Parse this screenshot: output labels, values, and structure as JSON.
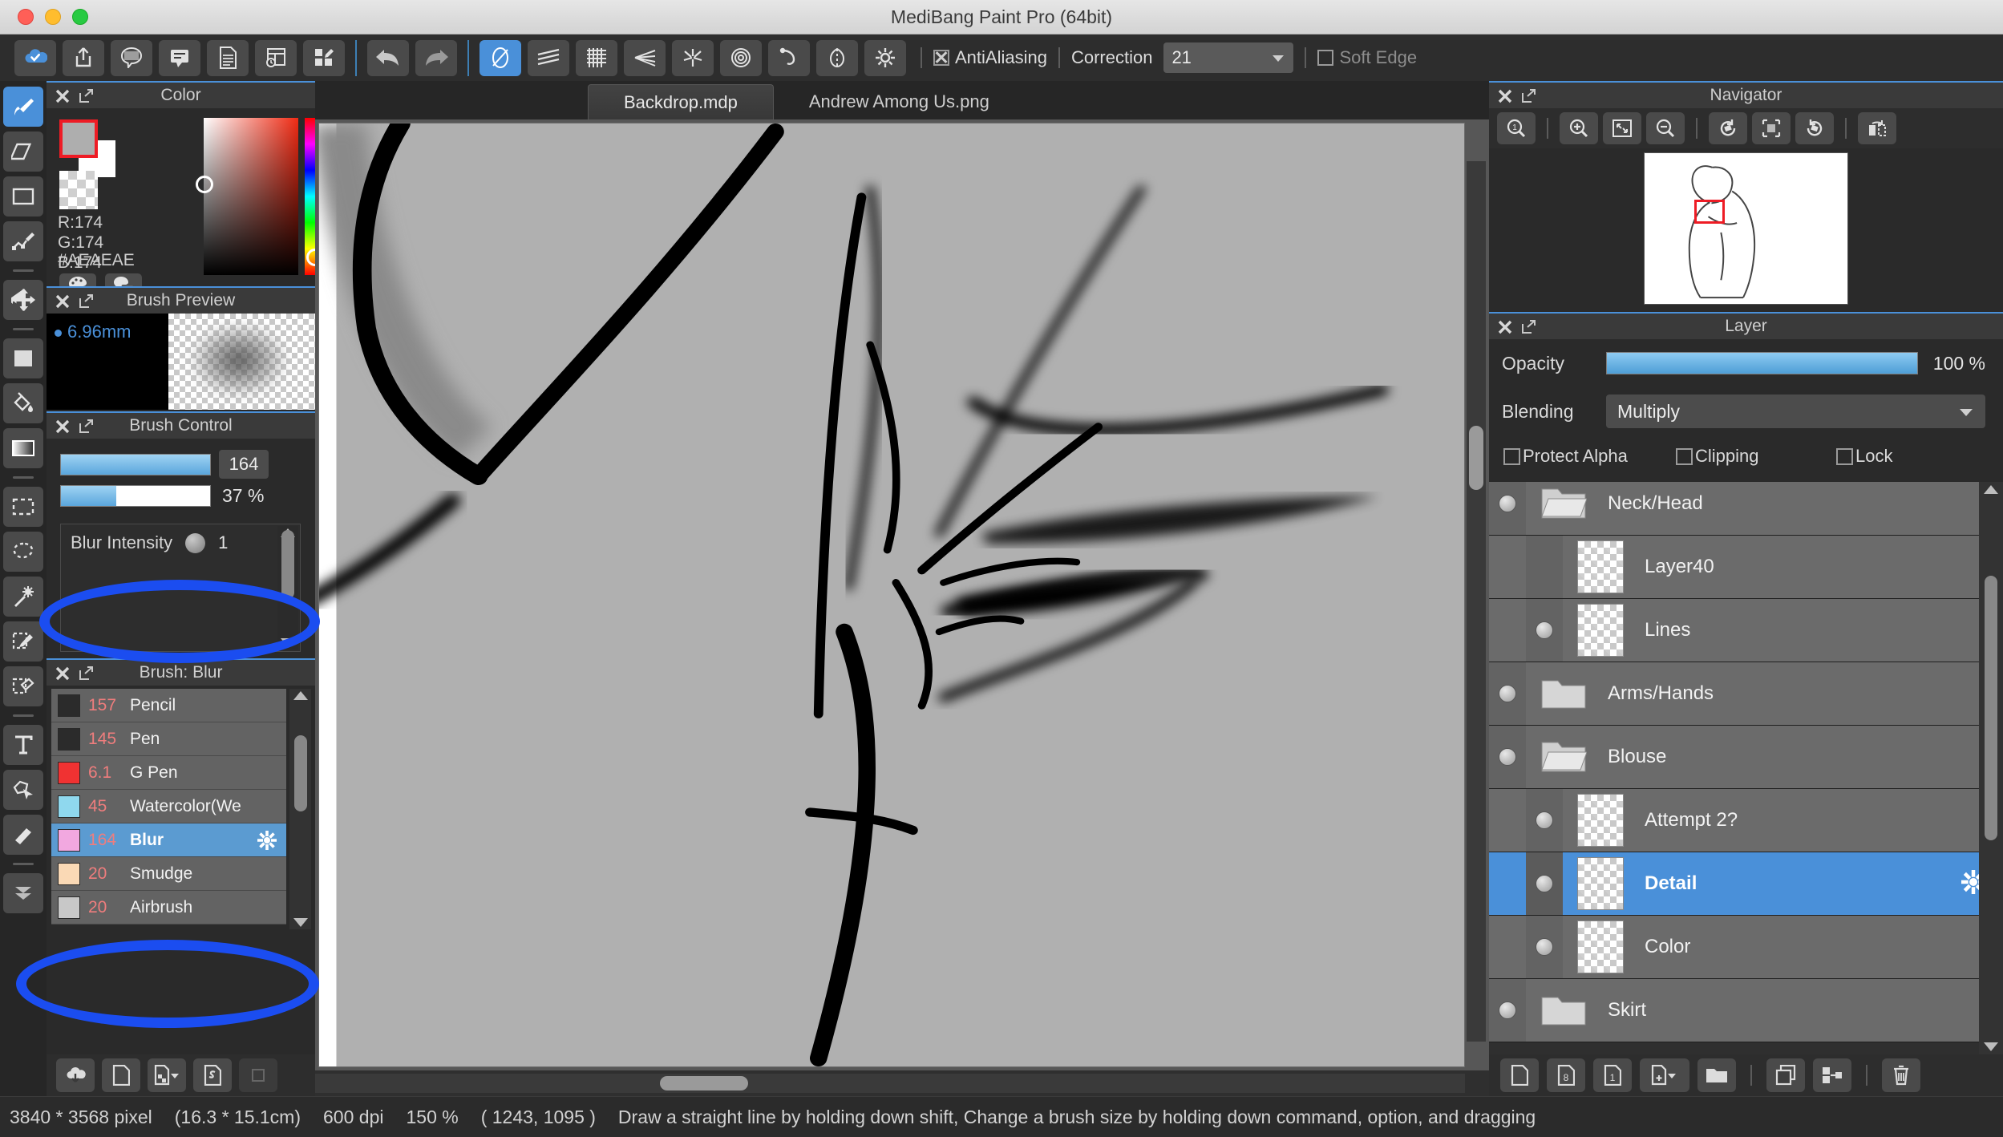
{
  "window": {
    "title": "MediBang Paint Pro (64bit)"
  },
  "toolbar": {
    "left_buttons": [
      {
        "name": "cloud-save-icon",
        "label": "Cloud"
      },
      {
        "name": "share-upload-icon",
        "label": "Share"
      },
      {
        "name": "comic-speech-icon",
        "label": "Comic"
      },
      {
        "name": "speech-balloon-icon",
        "label": "Balloon"
      },
      {
        "name": "page-icon",
        "label": "Page"
      },
      {
        "name": "page-manage-icon",
        "label": "Page Manage"
      },
      {
        "name": "panel-edit-icon",
        "label": "Panel Edit"
      }
    ],
    "undo_label": "Undo",
    "redo_label": "Redo",
    "brush_shape_buttons": [
      {
        "name": "no-correction-icon",
        "label": "No Correction",
        "active": true
      },
      {
        "name": "parallel-lines-icon",
        "label": "Parallel Line"
      },
      {
        "name": "grid-icon",
        "label": "Grid"
      },
      {
        "name": "converge-icon",
        "label": "Converging Line"
      },
      {
        "name": "radial-icon",
        "label": "Radial Line"
      },
      {
        "name": "concentric-icon",
        "label": "Concentric Circle"
      },
      {
        "name": "curve-icon",
        "label": "Curve"
      },
      {
        "name": "symmetry-icon",
        "label": "Symmetry"
      },
      {
        "name": "ruler-settings-icon",
        "label": "Ruler Settings"
      }
    ],
    "antialiasing_label": "AntiAliasing",
    "antialiasing_checked": true,
    "correction_label": "Correction",
    "correction_value": "21",
    "soft_edge_label": "Soft Edge",
    "soft_edge_checked": false
  },
  "tool_rail": [
    {
      "name": "brush-tool",
      "label": "Brush",
      "active": true
    },
    {
      "name": "eraser-tool",
      "label": "Eraser"
    },
    {
      "name": "shape-tool",
      "label": "Shape"
    },
    {
      "name": "polyline-tool",
      "label": "Polyline"
    },
    {
      "sep": true
    },
    {
      "name": "move-tool",
      "label": "Move"
    },
    {
      "sep": true
    },
    {
      "name": "fill-rect-tool",
      "label": "Fill Rect"
    },
    {
      "name": "bucket-tool",
      "label": "Bucket"
    },
    {
      "name": "gradient-tool",
      "label": "Gradient"
    },
    {
      "sep": true
    },
    {
      "name": "rect-select-tool",
      "label": "Select Rect"
    },
    {
      "name": "lasso-select-tool",
      "label": "Lasso"
    },
    {
      "name": "magic-wand-tool",
      "label": "Magic Wand"
    },
    {
      "name": "select-pen-tool",
      "label": "Select Pen"
    },
    {
      "name": "select-eraser-tool",
      "label": "Select Eraser"
    },
    {
      "sep": true
    },
    {
      "name": "text-tool",
      "label": "Text"
    },
    {
      "name": "transform-tool",
      "label": "Operation"
    },
    {
      "name": "hand-tool",
      "label": "Hand"
    },
    {
      "sep": true
    },
    {
      "name": "divide-tool",
      "label": "Divide"
    }
  ],
  "color_panel": {
    "title": "Color",
    "rgb": [
      "R:174",
      "G:174",
      "B:174"
    ],
    "hex": "#AEAEAE",
    "foreground": "#AEAEAE",
    "background": "#FFFFFF",
    "swatch_border": "#EE1C25"
  },
  "brush_preview": {
    "title": "Brush Preview",
    "size_label": "6.96mm",
    "size_color": "#4A90D9"
  },
  "brush_control": {
    "title": "Brush Control",
    "size_value": "164",
    "opacity_value": "37 %",
    "opacity_percent": 37,
    "blur_intensity_label": "Blur Intensity",
    "blur_intensity_value": "1"
  },
  "brush_list": {
    "title": "Brush: Blur",
    "rows": [
      {
        "num": "157",
        "name": "Pencil",
        "swatch": "#2b2b2b",
        "selected": false
      },
      {
        "num": "145",
        "name": "Pen",
        "swatch": "#2b2b2b",
        "selected": false
      },
      {
        "num": "6.1",
        "name": "G Pen",
        "swatch": "#f03232",
        "selected": false
      },
      {
        "num": "45",
        "name": "Watercolor(We",
        "swatch": "#8fd8ee",
        "selected": false
      },
      {
        "num": "164",
        "name": "Blur",
        "swatch": "#f2a8e0",
        "selected": true
      },
      {
        "num": "20",
        "name": "Smudge",
        "swatch": "#fad9b5",
        "selected": false
      },
      {
        "num": "20",
        "name": "Airbrush",
        "swatch": "#c8c8c8",
        "selected": false
      }
    ],
    "footer_buttons": [
      {
        "name": "download-brush-icon",
        "label": "Download Brush"
      },
      {
        "name": "add-brush-icon",
        "label": "Add Brush"
      },
      {
        "name": "add-brush-type-icon",
        "label": "Add Brush Type"
      },
      {
        "name": "script-brush-icon",
        "label": "Script Brush"
      },
      {
        "name": "brush-merge-icon",
        "label": "Merge",
        "disabled": true
      }
    ]
  },
  "tabs": [
    {
      "label": "Backdrop.mdp",
      "active": true
    },
    {
      "label": "Andrew Among Us.png",
      "active": false
    }
  ],
  "navigator": {
    "title": "Navigator",
    "buttons": [
      {
        "name": "zoom-reset-icon",
        "label": "Zoom 1:1"
      },
      {
        "name": "zoom-in-icon",
        "label": "Zoom In"
      },
      {
        "name": "fit-screen-icon",
        "label": "Fit to Screen"
      },
      {
        "name": "zoom-out-icon",
        "label": "Zoom Out"
      },
      {
        "name": "rotate-left-icon",
        "label": "Rotate Left"
      },
      {
        "name": "reset-rotate-icon",
        "label": "Reset Rotation"
      },
      {
        "name": "rotate-right-icon",
        "label": "Rotate Right"
      },
      {
        "name": "flip-horizontal-icon",
        "label": "Flip Horizontal"
      }
    ]
  },
  "layer_panel": {
    "title": "Layer",
    "opacity_label": "Opacity",
    "opacity_value": "100 %",
    "opacity_percent": 100,
    "blending_label": "Blending",
    "blending_value": "Multiply",
    "checkboxes": [
      {
        "name": "protect-alpha-checkbox",
        "label": "Protect Alpha",
        "checked": false
      },
      {
        "name": "clipping-checkbox",
        "label": "Clipping",
        "checked": false
      },
      {
        "name": "lock-checkbox",
        "label": "Lock",
        "checked": false
      }
    ],
    "layers": [
      {
        "name": "Neck/Head",
        "type": "folder-open",
        "visible": true,
        "child": false,
        "selected": false
      },
      {
        "name": "Layer40",
        "type": "layer",
        "visible": false,
        "child": true,
        "selected": false
      },
      {
        "name": "Lines",
        "type": "layer",
        "visible": true,
        "child": true,
        "selected": false
      },
      {
        "name": "Arms/Hands",
        "type": "folder-closed",
        "visible": true,
        "child": false,
        "selected": false
      },
      {
        "name": "Blouse",
        "type": "folder-open",
        "visible": true,
        "child": false,
        "selected": false
      },
      {
        "name": "Attempt 2?",
        "type": "layer",
        "visible": true,
        "child": true,
        "selected": false
      },
      {
        "name": "Detail",
        "type": "layer",
        "visible": true,
        "child": true,
        "selected": true
      },
      {
        "name": "Color",
        "type": "layer",
        "visible": true,
        "child": true,
        "selected": false
      },
      {
        "name": "Skirt",
        "type": "folder-closed",
        "visible": true,
        "child": false,
        "selected": false
      }
    ],
    "footer_buttons": [
      {
        "name": "new-layer-icon",
        "label": "Add Layer"
      },
      {
        "name": "new-8bit-layer-icon",
        "label": "Add 8bit Layer"
      },
      {
        "name": "new-1bit-layer-icon",
        "label": "Add 1bit Layer"
      },
      {
        "name": "add-layer-menu-icon",
        "label": "Add Layer Menu"
      },
      {
        "name": "new-folder-icon",
        "label": "Add Folder"
      },
      {
        "name": "duplicate-layer-icon",
        "label": "Duplicate Layer"
      },
      {
        "name": "merge-layer-icon",
        "label": "Merge Layer"
      },
      {
        "name": "delete-layer-icon",
        "label": "Delete Layer"
      }
    ]
  },
  "status_bar": {
    "dimensions": "3840 * 3568 pixel",
    "physical": "(16.3 * 15.1cm)",
    "dpi": "600 dpi",
    "zoom": "150 %",
    "coords": "( 1243, 1095 )",
    "hint": "Draw a straight line by holding down shift, Change a brush size by holding down command, option, and dragging"
  },
  "annotations": [
    {
      "name": "brush-opacity-highlight",
      "shape": "ellipse",
      "color": "#1B4DF0"
    },
    {
      "name": "blur-brush-highlight",
      "shape": "ellipse",
      "color": "#1B4DF0"
    }
  ]
}
